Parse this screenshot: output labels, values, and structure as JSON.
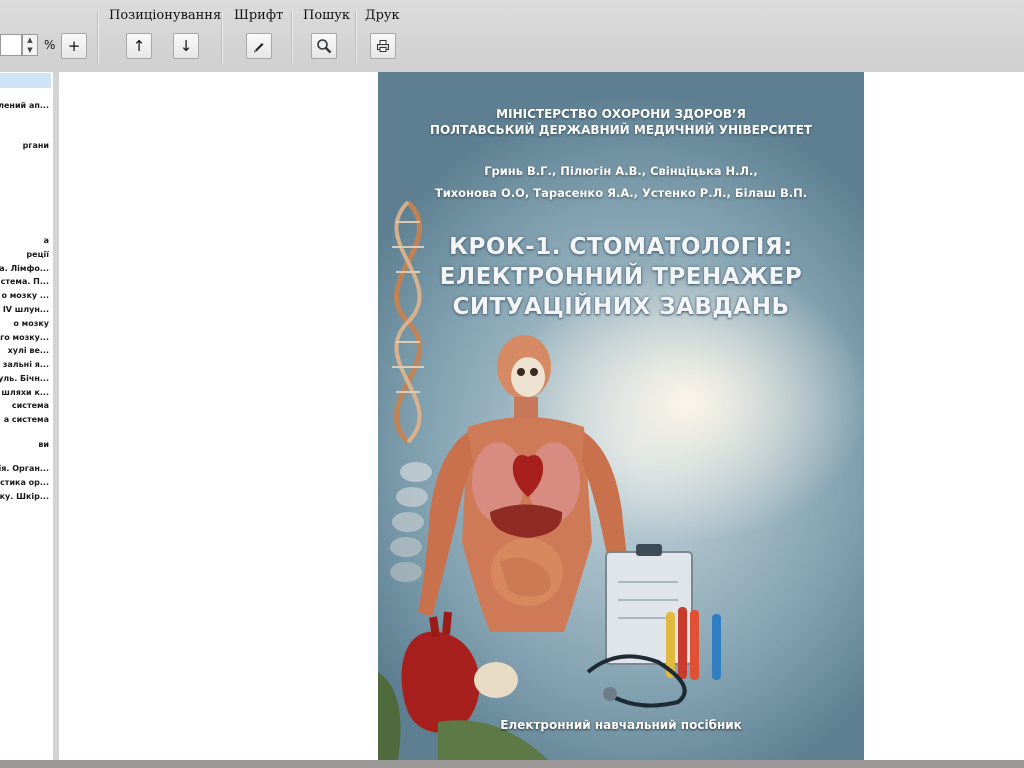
{
  "toolbar": {
    "positioning_label": "Позиціонування",
    "font_label": "Шрифт",
    "search_label": "Пошук",
    "print_label": "Друк",
    "zoom_unit": "%",
    "zoom_plus": "+",
    "up_arrow": "↑",
    "down_arrow": "↓",
    "spin_up": "▲",
    "spin_down": "▼"
  },
  "toc": {
    "items": [
      "лений ап...",
      "ргани",
      "а",
      "реції",
      "а. Лімфо...",
      "стема. П...",
      "о мозку ...",
      "IV шлун...",
      "о мозку",
      "го мозку...",
      "хулі ве...",
      "зальні я...",
      "уль. Бічн...",
      "шляхи к...",
      "система",
      "а система",
      "ви",
      "ія. Орган...",
      "стика ор...",
      "ку. Шкір..."
    ]
  },
  "cover": {
    "ministry_line1": "МІНІСТЕРСТВО ОХОРОНИ ЗДОРОВ’Я",
    "ministry_line2": "ПОЛТАВСЬКИЙ ДЕРЖАВНИЙ МЕДИЧНИЙ УНІВЕРСИТЕТ",
    "authors_line1": "Гринь В.Г., Пілюгін А.В., Свінціцька Н.Л.,",
    "authors_line2": "Тихонова О.О, Тарасенко Я.А., Устенко Р.Л., Білаш В.П.",
    "title_line1": "КРОК-1. СТОМАТОЛОГІЯ:",
    "title_line2": "ЕЛЕКТРОННИЙ ТРЕНАЖЕР",
    "title_line3": "СИТУАЦІЙНИХ ЗАВДАНЬ",
    "subtitle": "Електронний навчальний посібник"
  },
  "icons": {
    "font": "pen-icon",
    "search": "magnifier-icon",
    "print": "printer-icon"
  },
  "colors": {
    "toolbar": "#d4d4d4",
    "selection": "#cfe3f7",
    "cover_bg": "#7f9fae"
  }
}
